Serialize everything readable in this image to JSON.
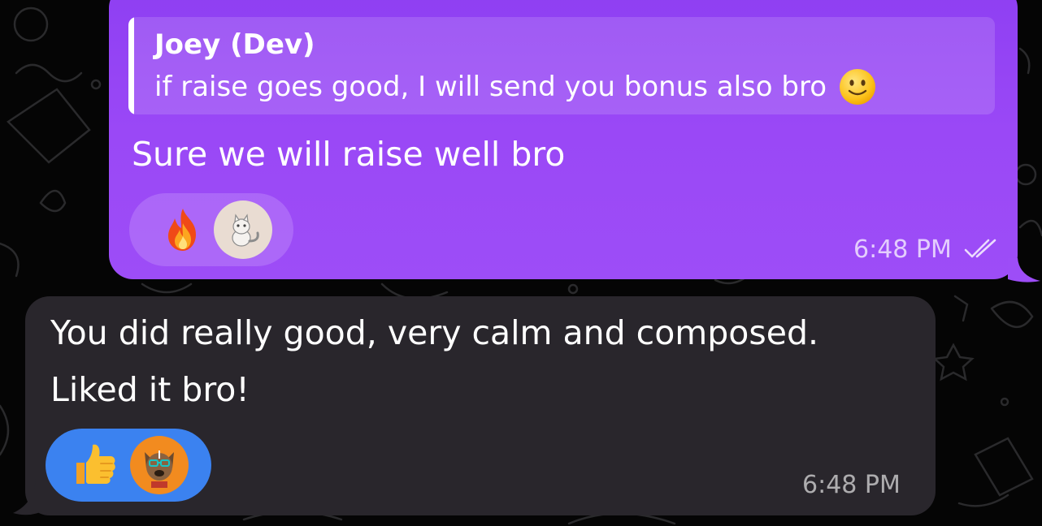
{
  "chat": {
    "outgoing": {
      "reply": {
        "author": "Joey (Dev)",
        "text": "if raise goes good, I will send you bonus also bro",
        "emoji_icon": "slightly-smiling-face-icon"
      },
      "text": "Sure we will raise well bro",
      "reactions": [
        {
          "emoji_icon": "fire-icon",
          "reactor_avatar": "cat-avatar"
        }
      ],
      "time": "6:48 PM",
      "status_icon": "double-check-icon",
      "bubble_color": "#9546f5"
    },
    "incoming": {
      "text_line_1": "You did really good, very calm and composed.",
      "text_line_2": "Liked it bro!",
      "reactions": [
        {
          "emoji_icon": "thumbs-up-icon",
          "reactor_avatar": "dog-avatar"
        }
      ],
      "time": "6:48 PM",
      "bubble_color": "#29262c",
      "reaction_color": "#3b82f0"
    }
  }
}
